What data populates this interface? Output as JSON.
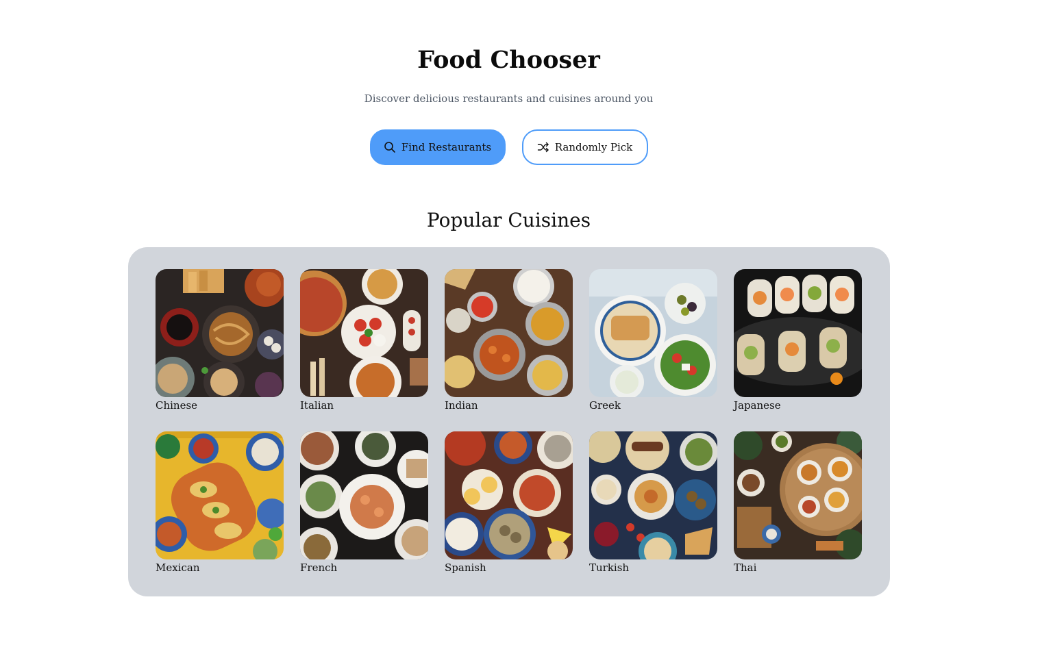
{
  "header": {
    "title": "Food Chooser",
    "subtitle": "Discover delicious restaurants and cuisines around you"
  },
  "actions": {
    "find": {
      "label": "Find Restaurants",
      "icon": "search-icon"
    },
    "random": {
      "label": "Randomly Pick",
      "icon": "shuffle-icon"
    }
  },
  "colors": {
    "accent": "#4f9cf9",
    "panel": "#d1d5db"
  },
  "cuisines": {
    "title": "Popular Cuisines",
    "items": [
      {
        "label": "Chinese"
      },
      {
        "label": "Italian"
      },
      {
        "label": "Indian"
      },
      {
        "label": "Greek"
      },
      {
        "label": "Japanese"
      },
      {
        "label": "Mexican"
      },
      {
        "label": "French"
      },
      {
        "label": "Spanish"
      },
      {
        "label": "Turkish"
      },
      {
        "label": "Thai"
      }
    ]
  }
}
